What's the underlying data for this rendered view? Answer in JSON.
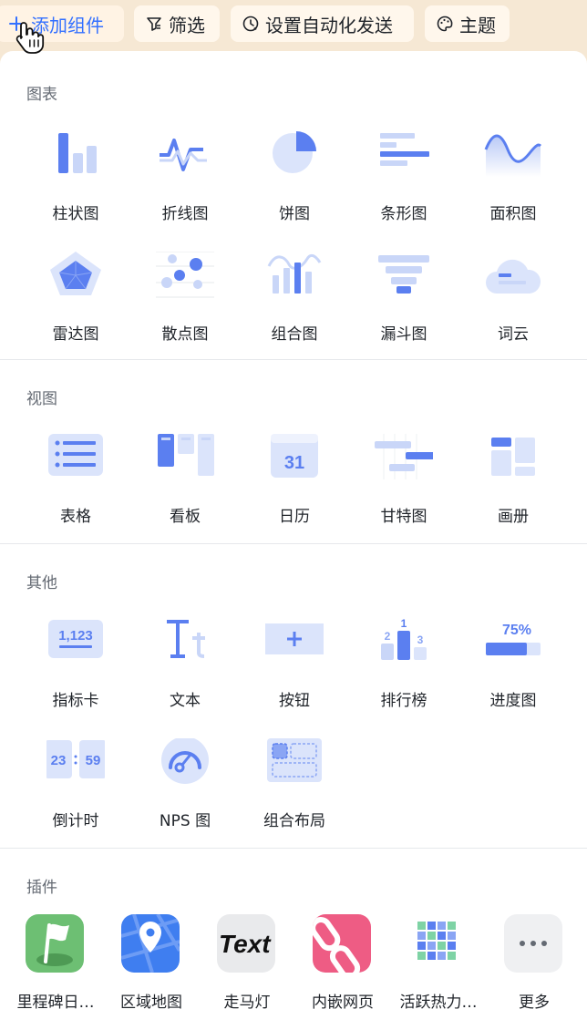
{
  "toolbar": {
    "add_widget": "添加组件",
    "filter": "筛选",
    "automation": "设置自动化发送",
    "theme": "主题"
  },
  "sections": {
    "charts": {
      "title": "图表",
      "items": [
        "柱状图",
        "折线图",
        "饼图",
        "条形图",
        "面积图",
        "雷达图",
        "散点图",
        "组合图",
        "漏斗图",
        "词云"
      ]
    },
    "views": {
      "title": "视图",
      "items": [
        "表格",
        "看板",
        "日历",
        "甘特图",
        "画册"
      ]
    },
    "others": {
      "title": "其他",
      "items": [
        "指标卡",
        "文本",
        "按钮",
        "排行榜",
        "进度图",
        "倒计时",
        "NPS 图",
        "组合布局"
      ]
    },
    "plugins": {
      "title": "插件",
      "items": [
        "里程碑日…",
        "区域地图",
        "走马灯",
        "内嵌网页",
        "活跃热力…",
        "更多"
      ]
    }
  },
  "icon_text": {
    "calendar_day": "31",
    "kpi_value": "1,123",
    "rank": [
      "1",
      "2",
      "3"
    ],
    "progress": "75%",
    "countdown": [
      "23",
      "59"
    ],
    "marquee": "Text"
  },
  "colors": {
    "accent": "#3370ff",
    "icon_blue": "#5b7ff0",
    "icon_light": "#dbe4fb",
    "toolbar_bg": "#f6e8d4"
  }
}
